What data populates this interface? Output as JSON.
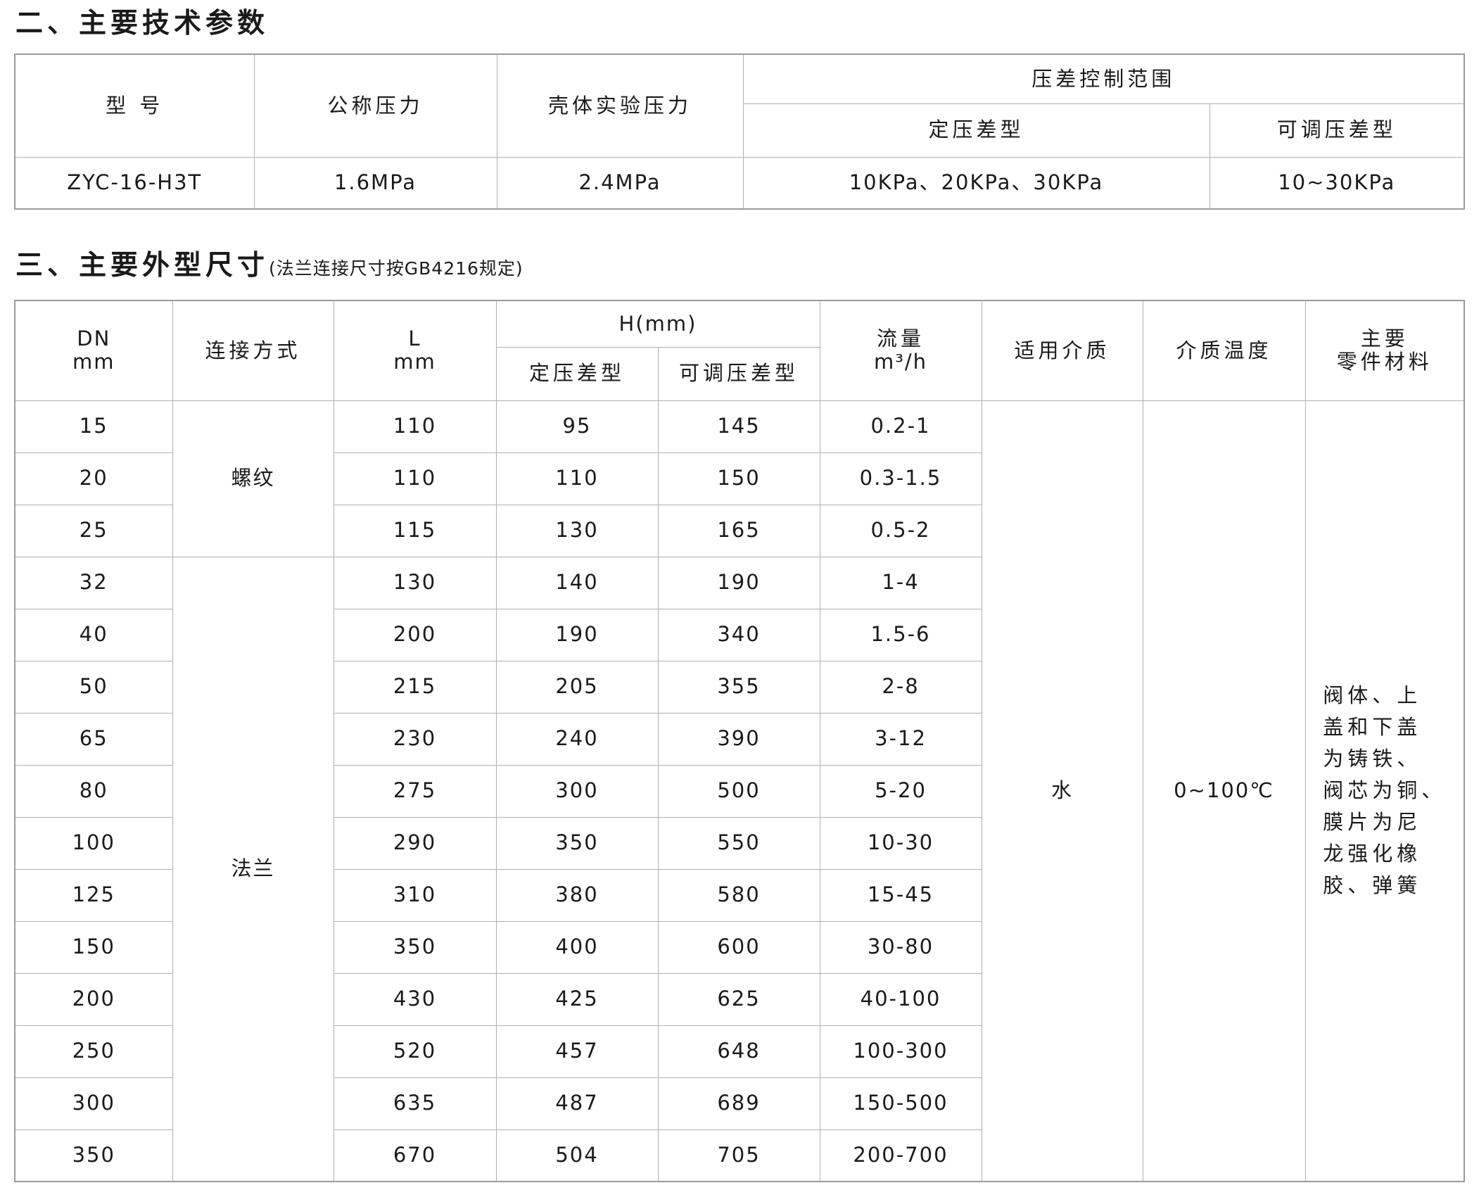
{
  "section2": {
    "title": "二、主要技术参数"
  },
  "tech_table": {
    "headers": {
      "model": "型 号",
      "nominal_pressure": "公称压力",
      "shell_test_pressure": "壳体实验压力",
      "diff_range": "压差控制范围",
      "fixed_type": "定压差型",
      "adjustable_type": "可调压差型"
    },
    "row": {
      "model": "ZYC-16-H3T",
      "nominal_pressure": "1.6MPa",
      "shell_test_pressure": "2.4MPa",
      "fixed_type": "10KPa、20KPa、30KPa",
      "adjustable_type": "10~30KPa"
    }
  },
  "section3": {
    "title": "三、主要外型尺寸",
    "note": "(法兰连接尺寸按GB4216规定)"
  },
  "dim_table": {
    "headers": {
      "dn": "DN",
      "dn_unit": "mm",
      "connection": "连接方式",
      "l": "L",
      "l_unit": "mm",
      "h": "H(mm)",
      "h_fixed": "定压差型",
      "h_adjustable": "可调压差型",
      "flow": "流量",
      "flow_unit": "m³/h",
      "medium": "适用介质",
      "temperature": "介质温度",
      "material_line1": "主要",
      "material_line2": "零件材料"
    },
    "connection_thread": "螺纹",
    "connection_flange": "法兰",
    "medium": "水",
    "temperature": "0~100℃",
    "material_lines": [
      "阀体、上",
      "盖和下盖",
      "为铸铁、",
      "阀芯为铜、",
      "膜片为尼",
      "龙强化橡",
      "胶、弹簧"
    ],
    "rows": [
      {
        "dn": "15",
        "l": "110",
        "h_fixed": "95",
        "h_adj": "145",
        "flow": "0.2-1"
      },
      {
        "dn": "20",
        "l": "110",
        "h_fixed": "110",
        "h_adj": "150",
        "flow": "0.3-1.5"
      },
      {
        "dn": "25",
        "l": "115",
        "h_fixed": "130",
        "h_adj": "165",
        "flow": "0.5-2"
      },
      {
        "dn": "32",
        "l": "130",
        "h_fixed": "140",
        "h_adj": "190",
        "flow": "1-4"
      },
      {
        "dn": "40",
        "l": "200",
        "h_fixed": "190",
        "h_adj": "340",
        "flow": "1.5-6"
      },
      {
        "dn": "50",
        "l": "215",
        "h_fixed": "205",
        "h_adj": "355",
        "flow": "2-8"
      },
      {
        "dn": "65",
        "l": "230",
        "h_fixed": "240",
        "h_adj": "390",
        "flow": "3-12"
      },
      {
        "dn": "80",
        "l": "275",
        "h_fixed": "300",
        "h_adj": "500",
        "flow": "5-20"
      },
      {
        "dn": "100",
        "l": "290",
        "h_fixed": "350",
        "h_adj": "550",
        "flow": "10-30"
      },
      {
        "dn": "125",
        "l": "310",
        "h_fixed": "380",
        "h_adj": "580",
        "flow": "15-45"
      },
      {
        "dn": "150",
        "l": "350",
        "h_fixed": "400",
        "h_adj": "600",
        "flow": "30-80"
      },
      {
        "dn": "200",
        "l": "430",
        "h_fixed": "425",
        "h_adj": "625",
        "flow": "40-100"
      },
      {
        "dn": "250",
        "l": "520",
        "h_fixed": "457",
        "h_adj": "648",
        "flow": "100-300"
      },
      {
        "dn": "300",
        "l": "635",
        "h_fixed": "487",
        "h_adj": "689",
        "flow": "150-500"
      },
      {
        "dn": "350",
        "l": "670",
        "h_fixed": "504",
        "h_adj": "705",
        "flow": "200-700"
      }
    ]
  }
}
